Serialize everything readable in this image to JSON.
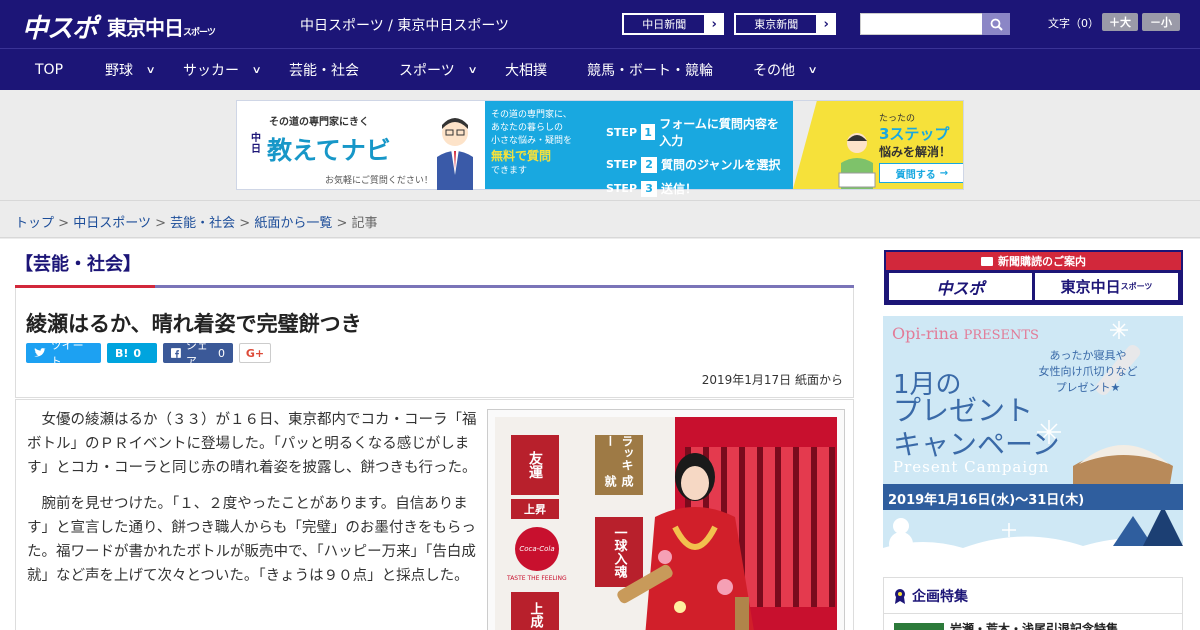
{
  "header": {
    "logo_primary": "中スポ",
    "logo_secondary": "東京中日",
    "logo_secondary_small": "スポーツ",
    "site_names": "中日スポーツ / 東京中日スポーツ",
    "ext_links": [
      {
        "label": "中日新聞",
        "arrow": "›"
      },
      {
        "label": "東京新聞",
        "arrow": "›"
      }
    ],
    "search": {
      "placeholder": "",
      "icon": "search-icon"
    },
    "font_size_label": "文字（0）",
    "font_larger": "＋大",
    "font_smaller": "－小"
  },
  "nav": {
    "items": [
      {
        "label": "TOP",
        "dropdown": false
      },
      {
        "label": "野球",
        "dropdown": true
      },
      {
        "label": "サッカー",
        "dropdown": true
      },
      {
        "label": "芸能・社会",
        "dropdown": false
      },
      {
        "label": "スポーツ",
        "dropdown": true
      },
      {
        "label": "大相撲",
        "dropdown": false
      },
      {
        "label": "競馬・ボート・競輪",
        "dropdown": false
      },
      {
        "label": "その他",
        "dropdown": true
      }
    ],
    "chevron": "∨"
  },
  "ad_banner": {
    "tagline": "その道の専門家にきく",
    "brand_small": "中日",
    "brand": "教えてナビ",
    "note": "お気軽にご質問ください！",
    "mid_lines": [
      "その道の専門家に、",
      "あなたの暮らしの",
      "小さな悩み・疑問を",
      "無料で質問",
      "できます"
    ],
    "steps": [
      {
        "step": "STEP",
        "num": "1",
        "text": "フォームに質問内容を入力"
      },
      {
        "step": "STEP",
        "num": "2",
        "text": "質問のジャンルを選択"
      },
      {
        "step": "STEP",
        "num": "3",
        "text": "送信！"
      }
    ],
    "right_line1": "たったの",
    "right_big": "3ステップ",
    "right_suffix": "で",
    "right_line2": "悩みを解消！",
    "right_cta": "質問する"
  },
  "breadcrumb": {
    "items": [
      "トップ",
      "中日スポーツ",
      "芸能・社会",
      "紙面から一覧"
    ],
    "current": "記事",
    "separator": ">"
  },
  "article": {
    "category": "【芸能・社会】",
    "title": "綾瀬はるか、晴れ着姿で完璧餅つき",
    "share": {
      "tweet": "ツイート",
      "hatena_label": "B!",
      "hatena_count": "0",
      "fb_label": "シェア",
      "fb_count": "0",
      "gplus": "G+"
    },
    "date": "2019年1月17日 紙面から",
    "paragraphs": [
      "女優の綾瀬はるか（３３）が１６日、東京都内でコカ・コーラ「福ボトル」のＰＲイベントに登場した。「パッと明るくなる感じがします」とコカ・コーラと同じ赤の晴れ着姿を披露し、餅つきも行った。",
      "腕前を見せつけた。「１、２度やったことがあります。自信あります」と宣言した通り、餅つき職人からも「完璧」のお墨付きをもらった。福ワードが書かれたボトルが販売中で、「ハッピー万来」「告白成就」など声を上げて次々とついた。「きょうは９０点」と採点した。"
    ],
    "photo_signs": [
      "友運",
      "上昇",
      "ラッキー",
      "成就",
      "一球",
      "入魂",
      "上成"
    ],
    "photo_logo": "Coca-Cola",
    "photo_logo_sub": "TASTE THE FEELING"
  },
  "sidebar": {
    "subscribe_head": "新聞購読のご案内",
    "subscribe_logos": [
      "中スポ",
      "東京中日"
    ],
    "subscribe_logo_small": "スポーツ",
    "promo": {
      "brand": "Opi-rina",
      "brand_suffix": "PRESENTS",
      "copy_lines": [
        "あったか寝具や",
        "女性向け爪切りなど",
        "プレゼント★"
      ],
      "month": "1月の",
      "campaign_lines": [
        "プレゼント",
        "キャンペーン"
      ],
      "english": "Present Campaign",
      "dates": "2019年1月16日(水)～31日(木)"
    },
    "feature_head": "企画特集",
    "feature_item": "岩瀬・荒木・浅尾引退記念特集"
  },
  "colors": {
    "brand_navy": "#1c1577",
    "accent_red": "#d2283b",
    "twitter": "#1da1f2",
    "hatena": "#00a4de",
    "facebook": "#3b5998"
  }
}
